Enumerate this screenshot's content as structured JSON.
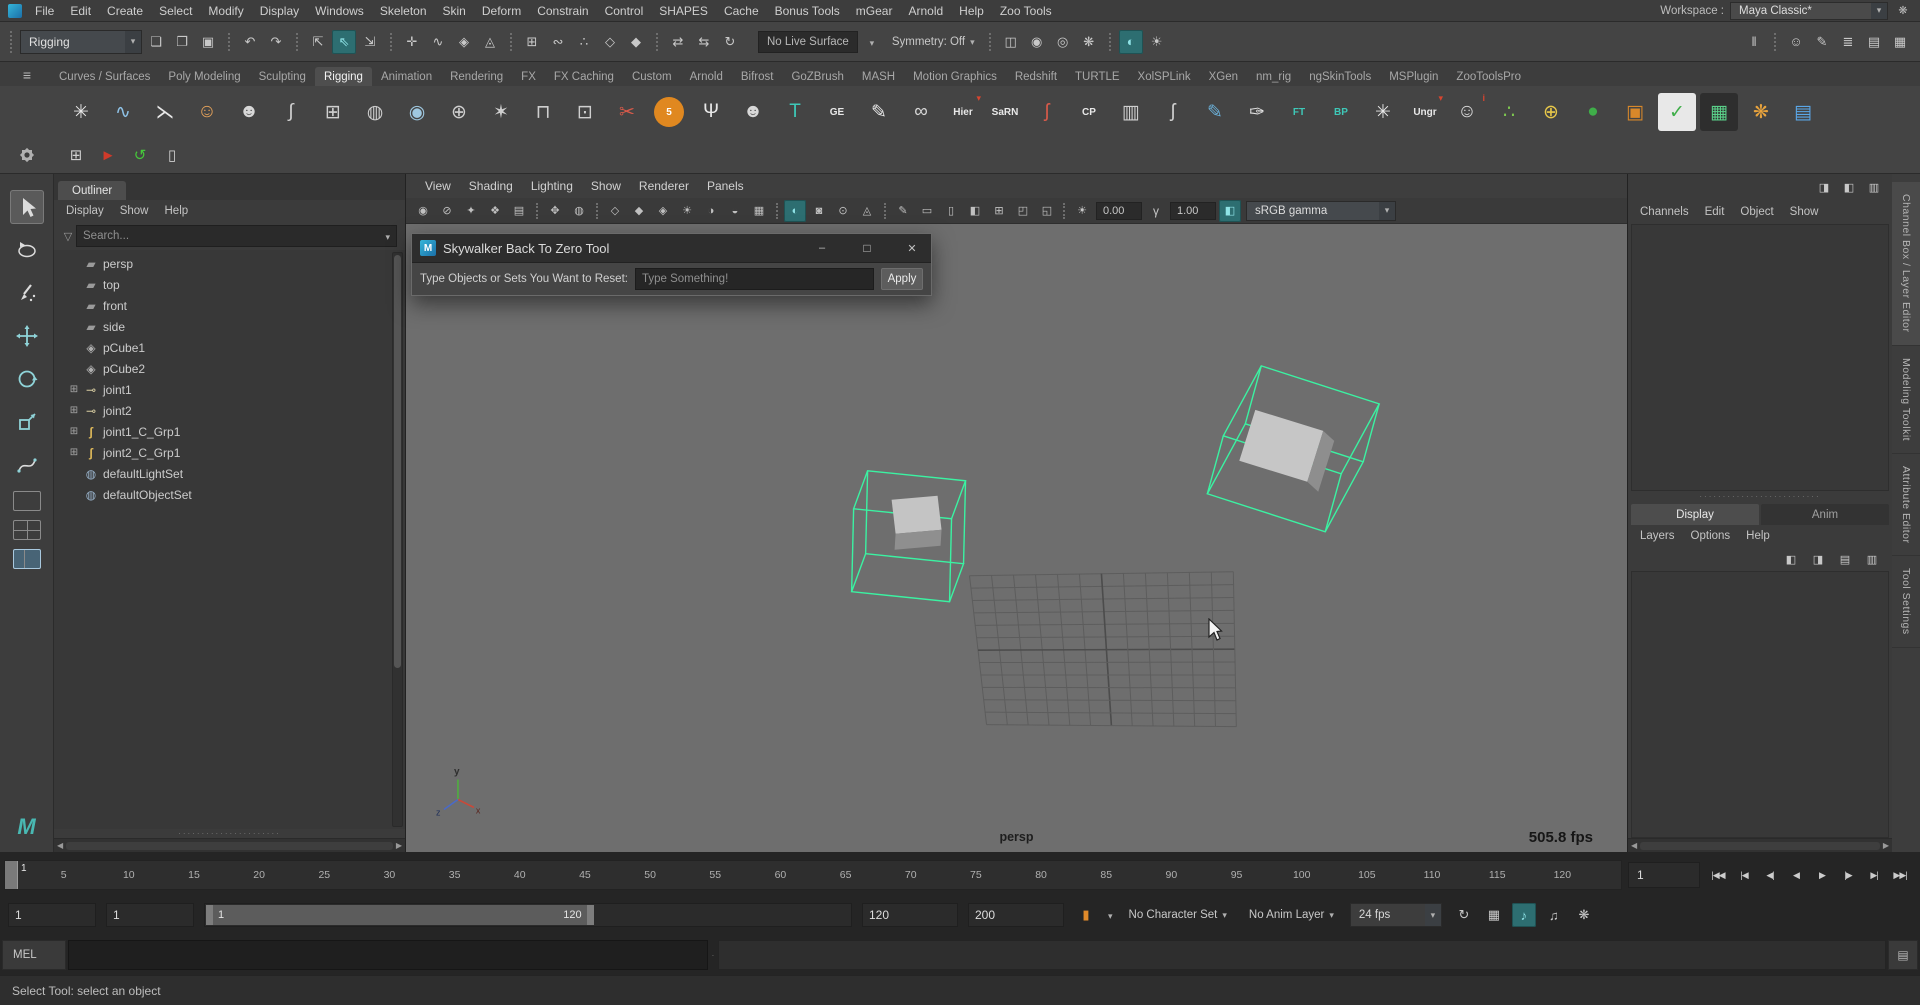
{
  "menubar": {
    "items": [
      "File",
      "Edit",
      "Create",
      "Select",
      "Modify",
      "Display",
      "Windows",
      "Skeleton",
      "Skin",
      "Deform",
      "Constrain",
      "Control",
      "SHAPES",
      "Cache",
      "Bonus Tools",
      "mGear",
      "Arnold",
      "Help",
      "Zoo Tools"
    ],
    "workspace_label": "Workspace :",
    "workspace_value": "Maya Classic*"
  },
  "statusline": {
    "mode": "Rigging",
    "no_live_surface": "No Live Surface",
    "symmetry": "Symmetry: Off",
    "icons_left": [
      {
        "name": "new-scene-icon",
        "glyph": "❏",
        "color": "#c8c8c8"
      },
      {
        "name": "open-scene-icon",
        "glyph": "❐",
        "color": "#c8c8c8"
      },
      {
        "name": "save-scene-icon",
        "glyph": "▣",
        "color": "#c8c8c8"
      },
      {
        "name": "undo-icon",
        "glyph": "↶",
        "color": "#c8c8c8",
        "divided": true
      },
      {
        "name": "redo-icon",
        "glyph": "↷",
        "color": "#c8c8c8"
      },
      {
        "name": "select-hierarchy-icon",
        "glyph": "⇱",
        "color": "#c8c8c8",
        "divided": true
      },
      {
        "name": "select-object-icon",
        "glyph": "⇖",
        "color": "#8fe3e6",
        "active": true
      },
      {
        "name": "select-component-icon",
        "glyph": "⇲",
        "color": "#c8c8c8"
      },
      {
        "name": "mask-handles-icon",
        "glyph": "✛",
        "color": "#c8c8c8",
        "divided": true
      },
      {
        "name": "mask-curves-icon",
        "glyph": "∿",
        "color": "#c8c8c8"
      },
      {
        "name": "mask-surfaces-icon",
        "glyph": "◈",
        "color": "#c8c8c8"
      },
      {
        "name": "mask-deformations-icon",
        "glyph": "◬",
        "color": "#c8c8c8"
      },
      {
        "name": "snap-grid-icon",
        "glyph": "⊞",
        "color": "#c8c8c8",
        "divided": true
      },
      {
        "name": "snap-curve-icon",
        "glyph": "∾",
        "color": "#c8c8c8"
      },
      {
        "name": "snap-point-icon",
        "glyph": "∴",
        "color": "#c8c8c8"
      },
      {
        "name": "snap-plane-icon",
        "glyph": "◇",
        "color": "#c8c8c8"
      },
      {
        "name": "snap-surface-icon",
        "glyph": "◆",
        "color": "#c8c8c8"
      },
      {
        "name": "input-connections-icon",
        "glyph": "⇄",
        "color": "#c8c8c8",
        "divided": true
      },
      {
        "name": "output-connections-icon",
        "glyph": "⇆",
        "color": "#c8c8c8"
      },
      {
        "name": "construction-history-icon",
        "glyph": "↻",
        "color": "#c8c8c8"
      }
    ],
    "icons_mid": [
      {
        "name": "render-view-icon",
        "glyph": "◫",
        "color": "#c8c8c8",
        "divided": true
      },
      {
        "name": "render-current-frame-icon",
        "glyph": "◉",
        "color": "#c8c8c8"
      },
      {
        "name": "ipr-render-icon",
        "glyph": "◎",
        "color": "#c8c8c8"
      },
      {
        "name": "render-settings-icon",
        "glyph": "❋",
        "color": "#c8c8c8"
      },
      {
        "name": "look-dev-icon",
        "glyph": "◐",
        "color": "#8fe3e6",
        "active": true,
        "divided": true
      },
      {
        "name": "light-editor-icon",
        "glyph": "☀",
        "color": "#c8c8c8"
      }
    ],
    "icons_right": [
      {
        "name": "pause-icon",
        "glyph": "‖",
        "color": "#c8c8c8"
      },
      {
        "name": "character-controls-icon",
        "glyph": "☺",
        "color": "#c8c8c8",
        "divided": true
      },
      {
        "name": "pose-editor-icon",
        "glyph": "✎",
        "color": "#c8c8c8"
      },
      {
        "name": "channel-sliders-icon",
        "glyph": "≣",
        "color": "#c8c8c8"
      },
      {
        "name": "display-layers-icon",
        "glyph": "▤",
        "color": "#c8c8c8"
      },
      {
        "name": "toolbox-grid-icon",
        "glyph": "▦",
        "color": "#c8c8c8"
      }
    ]
  },
  "shelf": {
    "tabs": [
      {
        "label": "Curves / Surfaces"
      },
      {
        "label": "Poly Modeling"
      },
      {
        "label": "Sculpting"
      },
      {
        "label": "Rigging",
        "active": true
      },
      {
        "label": "Animation"
      },
      {
        "label": "Rendering"
      },
      {
        "label": "FX"
      },
      {
        "label": "FX Caching"
      },
      {
        "label": "Custom"
      },
      {
        "label": "Arnold"
      },
      {
        "label": "Bifrost"
      },
      {
        "label": "GoZBrush"
      },
      {
        "label": "MASH"
      },
      {
        "label": "Motion Graphics"
      },
      {
        "label": "Redshift"
      },
      {
        "label": "TURTLE"
      },
      {
        "label": "XolSPLink"
      },
      {
        "label": "XGen"
      },
      {
        "label": "nm_rig"
      },
      {
        "label": "ngSkinTools"
      },
      {
        "label": "MSPlugin"
      },
      {
        "label": "ZooToolsPro"
      }
    ],
    "row1": [
      {
        "name": "snap-asterisk-icon",
        "glyph": "✳",
        "color": "#e8e8e8"
      },
      {
        "name": "ep-curve-icon",
        "glyph": "∿",
        "color": "#8fc3e8"
      },
      {
        "name": "joint-tool-icon",
        "glyph": "⋋",
        "color": "#e8e8e8"
      },
      {
        "name": "humanik-icon",
        "glyph": "☺",
        "color": "#e2a05a"
      },
      {
        "name": "character-icon",
        "glyph": "☻",
        "color": "#d8d8d8"
      },
      {
        "name": "hook-icon",
        "glyph": "∫",
        "color": "#cfcfcf"
      },
      {
        "name": "poly-grid-icon",
        "glyph": "⊞",
        "color": "#cfcfcf"
      },
      {
        "name": "circle-lattice-icon",
        "glyph": "◍",
        "color": "#cfcfcf"
      },
      {
        "name": "sphere-lattice-icon",
        "glyph": "◉",
        "color": "#9fc8e0"
      },
      {
        "name": "rivet-icon",
        "glyph": "⊕",
        "color": "#cfcfcf"
      },
      {
        "name": "web-joints-icon",
        "glyph": "✶",
        "color": "#cfcfcf"
      },
      {
        "name": "h-bracket-icon",
        "glyph": "⊓",
        "color": "#cfcfcf"
      },
      {
        "name": "duplicate-icon",
        "glyph": "⊡",
        "color": "#cfcfcf"
      },
      {
        "name": "cut-joint-icon",
        "glyph": "✂",
        "color": "#d85a4a"
      },
      {
        "name": "five-ball-icon",
        "label": "5",
        "circle": true,
        "bg": "#e08820",
        "color": "#ffffff"
      },
      {
        "name": "ik-handle-icon",
        "glyph": "Ψ",
        "color": "#e8e8e8"
      },
      {
        "name": "face-mask-icon",
        "glyph": "☻",
        "color": "#d8d8d8"
      },
      {
        "name": "teal-t-icon",
        "glyph": "T",
        "color": "#3ec8b8"
      },
      {
        "name": "ge-icon",
        "label": "GE",
        "color": "#e8e8e8"
      },
      {
        "name": "brush-icon",
        "glyph": "✎",
        "color": "#e8e8e8"
      },
      {
        "name": "goggles-icon",
        "glyph": "∞",
        "color": "#d8d8d8"
      },
      {
        "name": "hier-icon",
        "label": "Hier",
        "color": "#e8e8e8",
        "mark": "▾"
      },
      {
        "name": "sarn-icon",
        "label": "SaRN",
        "color": "#e8e8e8"
      },
      {
        "name": "red-hook-icon",
        "glyph": "ʃ",
        "color": "#d85a4a"
      },
      {
        "name": "cp-icon",
        "label": "CP",
        "color": "#e8e8e8"
      },
      {
        "name": "barrel-icon",
        "glyph": "▥",
        "color": "#cfcfcf"
      },
      {
        "name": "gray-hook-icon",
        "glyph": "ʃ",
        "color": "#cfcfcf"
      },
      {
        "name": "blue-brush-icon",
        "glyph": "✎",
        "color": "#6aaed6"
      },
      {
        "name": "dropper-icon",
        "glyph": "✑",
        "color": "#e8e8e8"
      },
      {
        "name": "ft-icon",
        "label": "FT",
        "color": "#3ec8b8"
      },
      {
        "name": "bp-icon",
        "label": "BP",
        "color": "#3ec8b8"
      },
      {
        "name": "asterisk-icon",
        "glyph": "✳",
        "color": "#e8e8e8"
      },
      {
        "name": "ungroup-icon",
        "label": "Ungr",
        "color": "#e8e8e8",
        "mark": "▾"
      },
      {
        "name": "person-info-icon",
        "glyph": "☺",
        "color": "#d8d8d8",
        "mark": "i"
      },
      {
        "name": "green-sparks-icon",
        "glyph": "∴",
        "color": "#7ec850"
      },
      {
        "name": "target-icon",
        "glyph": "⊕",
        "color": "#e8c84a"
      },
      {
        "name": "green-ball-icon",
        "glyph": "●",
        "color": "#3fae49"
      },
      {
        "name": "crate-icon",
        "glyph": "▣",
        "color": "#d8882a"
      },
      {
        "name": "checklist-icon",
        "glyph": "✓",
        "color": "#3fae49",
        "bg": "#e8e8e8"
      },
      {
        "name": "dark-grid-icon",
        "glyph": "▦",
        "color": "#5ad089",
        "bg": "#2e2e2e"
      },
      {
        "name": "gear-orange-icon",
        "glyph": "❋",
        "color": "#e8a33d"
      },
      {
        "name": "layers-blue-icon",
        "glyph": "▤",
        "color": "#5aa7e8"
      }
    ],
    "row2": [
      {
        "name": "move-grid-icon",
        "glyph": "⊞",
        "color": "#cfcfcf"
      },
      {
        "name": "red-flag-icon",
        "glyph": "►",
        "color": "#d03a2a"
      },
      {
        "name": "green-swirl-icon",
        "glyph": "↺",
        "color": "#45c83a"
      },
      {
        "name": "trash-icon",
        "glyph": "▯",
        "color": "#cfcfcf"
      }
    ]
  },
  "outliner": {
    "tab_label": "Outliner",
    "menus": [
      "Display",
      "Show",
      "Help"
    ],
    "search_placeholder": "Search...",
    "items": [
      {
        "label": "persp",
        "icon": "camera"
      },
      {
        "label": "top",
        "icon": "camera"
      },
      {
        "label": "front",
        "icon": "camera"
      },
      {
        "label": "side",
        "icon": "camera"
      },
      {
        "label": "pCube1",
        "icon": "mesh"
      },
      {
        "label": "pCube2",
        "icon": "mesh"
      },
      {
        "label": "joint1",
        "icon": "joint",
        "expandable": true
      },
      {
        "label": "joint2",
        "icon": "joint",
        "expandable": true
      },
      {
        "label": "joint1_C_Grp1",
        "icon": "group",
        "expandable": true
      },
      {
        "label": "joint2_C_Grp1",
        "icon": "group",
        "expandable": true
      },
      {
        "label": "defaultLightSet",
        "icon": "set"
      },
      {
        "label": "defaultObjectSet",
        "icon": "set"
      }
    ]
  },
  "viewport": {
    "menus": [
      "View",
      "Shading",
      "Lighting",
      "Show",
      "Renderer",
      "Panels"
    ],
    "toolbar_icons": [
      {
        "name": "select-camera-icon",
        "glyph": "◉",
        "color": "#c0c0c0"
      },
      {
        "name": "lock-camera-icon",
        "glyph": "⊘",
        "color": "#c0c0c0"
      },
      {
        "name": "camera-attributes-icon",
        "glyph": "✦",
        "color": "#c0c0c0"
      },
      {
        "name": "bookmarks-icon",
        "glyph": "❖",
        "color": "#c0c0c0"
      },
      {
        "name": "image-plane-icon",
        "glyph": "▤",
        "color": "#c0c0c0"
      },
      {
        "name": "pan-zoom-icon",
        "glyph": "✥",
        "color": "#c0c0c0",
        "divided": true
      },
      {
        "name": "oversampling-icon",
        "glyph": "◍",
        "color": "#c0c0c0"
      },
      {
        "name": "wireframe-icon",
        "glyph": "◇",
        "color": "#c0c0c0",
        "divided": true
      },
      {
        "name": "shaded-icon",
        "glyph": "◆",
        "color": "#c0c0c0"
      },
      {
        "name": "textured-icon",
        "glyph": "◈",
        "color": "#c0c0c0"
      },
      {
        "name": "lights-icon",
        "glyph": "☀",
        "color": "#c0c0c0"
      },
      {
        "name": "shadows-icon",
        "glyph": "◑",
        "color": "#c0c0c0"
      },
      {
        "name": "ao-icon",
        "glyph": "◒",
        "color": "#c0c0c0"
      },
      {
        "name": "antialias-icon",
        "glyph": "▦",
        "color": "#c0c0c0"
      },
      {
        "name": "default-material-icon",
        "glyph": "◐",
        "color": "#8fe3e6",
        "active": true,
        "divided": true
      },
      {
        "name": "xray-icon",
        "glyph": "◙",
        "color": "#c0c0c0"
      },
      {
        "name": "xray-joints-icon",
        "glyph": "⊙",
        "color": "#c0c0c0"
      },
      {
        "name": "isolate-select-icon",
        "glyph": "◬",
        "color": "#c0c0c0"
      },
      {
        "name": "grease-pencil-icon",
        "glyph": "✎",
        "color": "#c0c0c0",
        "divided": true
      },
      {
        "name": "film-gate-icon",
        "glyph": "▭",
        "color": "#c0c0c0"
      },
      {
        "name": "resolution-gate-icon",
        "glyph": "▯",
        "color": "#c0c0c0"
      },
      {
        "name": "gate-mask-icon",
        "glyph": "◧",
        "color": "#c0c0c0"
      },
      {
        "name": "field-chart-icon",
        "glyph": "⊞",
        "color": "#c0c0c0"
      },
      {
        "name": "safe-action-icon",
        "glyph": "◰",
        "color": "#c0c0c0"
      },
      {
        "name": "safe-title-icon",
        "glyph": "◱",
        "color": "#c0c0c0"
      }
    ],
    "exposure": "0.00",
    "gamma": "1.00",
    "color_transform": "sRGB gamma",
    "camera_label": "persp",
    "fps_label": "505.8 fps"
  },
  "dialog": {
    "title": "Skywalker Back To Zero Tool",
    "prompt": "Type Objects or Sets You Want to Reset:",
    "input_placeholder": "Type Something!",
    "apply_label": "Apply"
  },
  "channelbox": {
    "header_icons": [
      {
        "name": "toggle-channel-box-icon",
        "glyph": "◨"
      },
      {
        "name": "toggle-attribute-editor-icon",
        "glyph": "◧"
      },
      {
        "name": "toggle-tool-settings-icon",
        "glyph": "▥"
      }
    ],
    "menus": [
      "Channels",
      "Edit",
      "Object",
      "Show"
    ],
    "layer_tabs": [
      {
        "label": "Display",
        "active": true
      },
      {
        "label": "Anim"
      }
    ],
    "layer_menus": [
      "Layers",
      "Options",
      "Help"
    ],
    "layer_icons": [
      {
        "name": "layer-toggle-all-icon",
        "glyph": "◧"
      },
      {
        "name": "layer-sync-icon",
        "glyph": "◨"
      },
      {
        "name": "new-empty-layer-icon",
        "glyph": "▤"
      },
      {
        "name": "new-layer-from-selected-icon",
        "glyph": "▥"
      }
    ]
  },
  "sidebar": {
    "tabs": [
      "Channel Box / Layer Editor",
      "Modeling Toolkit",
      "Attribute Editor",
      "Tool Settings"
    ]
  },
  "timeline": {
    "ticks": [
      5,
      10,
      15,
      20,
      25,
      30,
      35,
      40,
      45,
      50,
      55,
      60,
      65,
      70,
      75,
      80,
      85,
      90,
      95,
      100,
      105,
      110,
      115,
      120
    ],
    "visible_end": 124,
    "current_frame": "1",
    "current_time": "1",
    "playback_buttons": [
      {
        "name": "go-to-start-button",
        "label": "|◀◀"
      },
      {
        "name": "step-back-frame-button",
        "label": "|◀"
      },
      {
        "name": "step-back-key-button",
        "label": "◀|"
      },
      {
        "name": "play-backwards-button",
        "label": "◀"
      },
      {
        "name": "play-forwards-button",
        "label": "▶"
      },
      {
        "name": "step-forward-key-button",
        "label": "|▶"
      },
      {
        "name": "step-forward-frame-button",
        "label": "▶|"
      },
      {
        "name": "go-to-end-button",
        "label": "▶▶|"
      }
    ]
  },
  "rangebar": {
    "anim_start": "1",
    "play_start": "1",
    "bar_start": "1",
    "bar_end": "120",
    "play_end": "120",
    "anim_end": "200",
    "character_set_icon": {
      "name": "character-set-icon",
      "glyph": "▮",
      "color": "#e08a2a"
    },
    "character_set": "No Character Set",
    "anim_layer": "No Anim Layer",
    "fps": "24 fps",
    "icons_right": [
      {
        "name": "playback-loop-icon",
        "glyph": "↻",
        "color": "#c8c8c8"
      },
      {
        "name": "snap-keys-icon",
        "glyph": "▦",
        "color": "#c8c8c8"
      },
      {
        "name": "sound-icon",
        "glyph": "♪",
        "color": "#8fe3e6",
        "active": true
      },
      {
        "name": "mute-icon",
        "glyph": "♫",
        "color": "#c8c8c8"
      },
      {
        "name": "animation-preferences-icon",
        "glyph": "❋",
        "color": "#c8c8c8"
      }
    ]
  },
  "commandline": {
    "label": "MEL",
    "icon_glyph": "▤"
  },
  "helpline": {
    "text": "Select Tool: select an object"
  },
  "colors": {
    "selection_wireframe": "#3bf2a2",
    "active_highlight": "#2d6e71",
    "accent_blue": "#5285a6",
    "viewport_bg": "#6e6e6e"
  }
}
